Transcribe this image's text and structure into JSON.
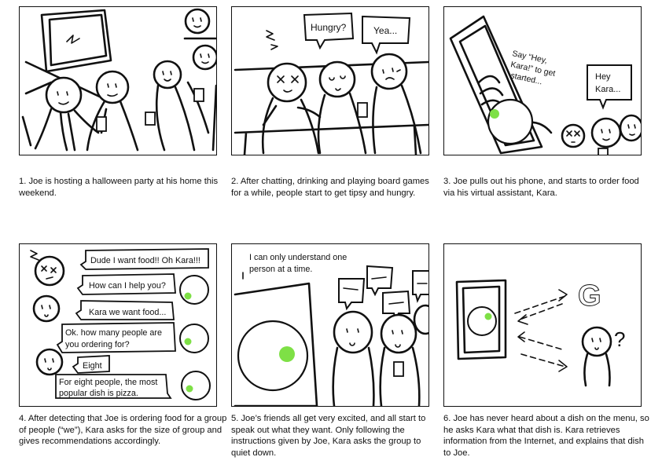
{
  "panels": [
    {
      "caption": "1. Joe is hosting a halloween party at his home this weekend.",
      "bubbles": []
    },
    {
      "caption": "2. After chatting, drinking and playing board games for a while, people start to get tipsy and hungry.",
      "bubbles": [
        "Hungry?",
        "Yea..."
      ]
    },
    {
      "caption": "3. Joe pulls out his phone, and starts to order food via his virtual assistant, Kara.",
      "bubbles": [
        "Say “Hey,",
        "Kara!” to get",
        "started...",
        "Hey",
        "Kara..."
      ]
    },
    {
      "caption": "4. After detecting that Joe is ordering food for a group of people (“we”), Kara asks for the size of group and gives recommendations accordingly.",
      "bubbles": [
        "Dude I want food!! Oh Kara!!!",
        "How can I help you?",
        "Kara we want food...",
        "Ok. how many people are",
        "you ordering for?",
        "Eight",
        "For eight people, the most",
        "popular dish is pizza."
      ]
    },
    {
      "caption": "5. Joe’s friends all get very excited, and all start to speak out what they want. Only following the instructions given by Joe, Kara asks the group to quiet down.",
      "bubbles": [
        "I can only understand one",
        "person at a time."
      ]
    },
    {
      "caption": "6. Joe has never heard about a dish on the menu, so he asks Kara what that dish is. Kara retrieves information from the Internet, and explains that dish to Joe.",
      "bubbles": [
        "G",
        "?"
      ]
    }
  ],
  "colors": {
    "kara_dot": "#7ee046",
    "ink": "#111111"
  }
}
